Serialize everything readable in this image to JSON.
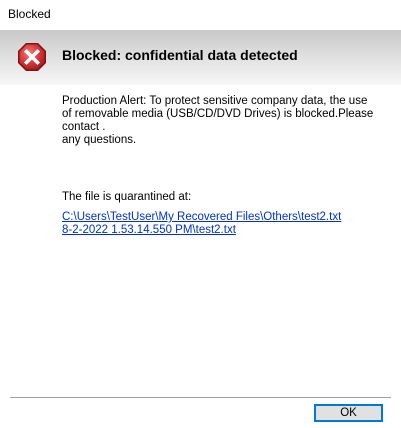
{
  "window": {
    "title": "Blocked"
  },
  "banner": {
    "icon": "error-x-icon",
    "icon_color": "#c9302c",
    "headline": "Blocked: confidential data detected"
  },
  "message": {
    "lines": [
      "Production Alert: To protect sensitive company data, the use",
      "of removable media (USB/CD/DVD Drives) is blocked.Please",
      "contact .",
      "any questions."
    ]
  },
  "quarantine": {
    "label": "The file is quarantined at:",
    "path_lines": [
      "C:\\Users\\TestUser\\My Recovered Files\\Others\\test2.txt",
      "8-2-2022 1.53.14.550 PM\\test2.txt"
    ],
    "link_color": "#0033cc"
  },
  "buttons": {
    "ok_label": "OK"
  }
}
